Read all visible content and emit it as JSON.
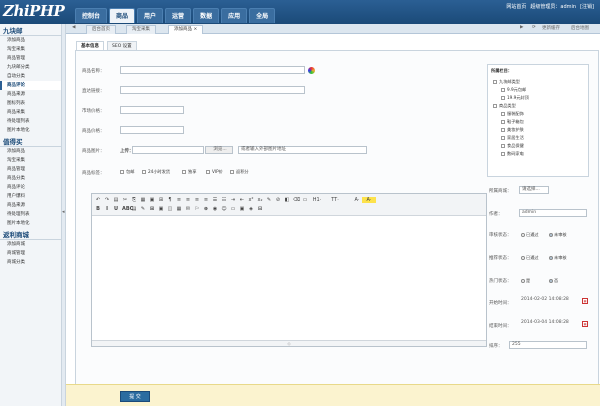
{
  "brand": {
    "logo": "ZhiPHP"
  },
  "topnav": [
    {
      "label": "控制台",
      "active": false
    },
    {
      "label": "商品",
      "active": true
    },
    {
      "label": "用户",
      "active": false
    },
    {
      "label": "运营",
      "active": false
    },
    {
      "label": "数据",
      "active": false
    },
    {
      "label": "应用",
      "active": false
    },
    {
      "label": "全局",
      "active": false
    }
  ],
  "toplinks": [
    "网站首页",
    "超级管理员：admin",
    "[注销]"
  ],
  "pagetabs": [
    "后台首页",
    "淘宝采集",
    "添加商品"
  ],
  "pagetab_close": "×",
  "tabtools": [
    "更新缓存",
    "后台地图"
  ],
  "sidebar": [
    {
      "title": "九块邮",
      "items": [
        "添加商品",
        "淘宝采集",
        "商品管理",
        "九块邮分类",
        "自动分类",
        "商品评论",
        "商品来源",
        "图标列表",
        "商品采集",
        "待处理列表",
        "图片本地化"
      ],
      "active": 5
    },
    {
      "title": "值得买",
      "items": [
        "添加商品",
        "淘宝采集",
        "商品管理",
        "商品分类",
        "商品评论",
        "用户爆料",
        "商品来源",
        "待处理列表",
        "图片本地化"
      ],
      "active": -1
    },
    {
      "title": "返利商城",
      "items": [
        "添加商城",
        "商城管理",
        "商城分类"
      ],
      "active": -1
    }
  ],
  "formtabs": [
    "基本信息",
    "SEO 设置"
  ],
  "form": {
    "name_label": "商品名称：",
    "link_label": "直达链接：",
    "price_label": "市场价格：",
    "sale_label": "商品价格：",
    "image_label": "商品图片：",
    "upload_label": "上传：",
    "browse_label": "浏览...",
    "image_placeholder": "或者输入外部图片地址",
    "tag_label": "商品标签：",
    "tags": [
      "包邮",
      "24小时发货",
      "独享",
      "VIP价",
      "返积分"
    ]
  },
  "category": {
    "title": "所属栏目：",
    "items": [
      {
        "label": "九块邮类型",
        "level": 0
      },
      {
        "label": "9.9元包邮",
        "level": 1
      },
      {
        "label": "19.9元封顶",
        "level": 1
      },
      {
        "label": "商品类型",
        "level": 0
      },
      {
        "label": "服装配饰",
        "level": 1
      },
      {
        "label": "鞋子箱包",
        "level": 1
      },
      {
        "label": "美妆护肤",
        "level": 1
      },
      {
        "label": "家居生活",
        "level": 1
      },
      {
        "label": "食品保健",
        "level": 1
      },
      {
        "label": "数码家电",
        "level": 1
      }
    ]
  },
  "props": {
    "mall_label": "所属商城：",
    "mall_value": "请选择...",
    "author_label": "作者：",
    "author_value": "admin",
    "audit_label": "审核状态：",
    "audit_opts": [
      "已通过",
      "未审核"
    ],
    "audit_selected": 1,
    "rec_label": "推荐状态：",
    "rec_opts": [
      "已通过",
      "未审核"
    ],
    "rec_selected": 1,
    "hot_label": "热门状态：",
    "hot_opts": [
      "是",
      "否"
    ],
    "hot_selected": 1,
    "start_label": "开始时间：",
    "start_value": "2014-02-02 14:08:28",
    "end_label": "结束时间：",
    "end_value": "2014-03-04 14:08:28",
    "sort_label": "排序：",
    "sort_value": "255"
  },
  "editor": {
    "heading_btn": "H1·",
    "font_btn": "TT·",
    "size_btn": "A·",
    "color_btn": "A·",
    "footer": "◇"
  },
  "submit_label": "提 交",
  "colors": {
    "accent": "#2b5f94",
    "footer_bg": "#fbf3cf"
  }
}
